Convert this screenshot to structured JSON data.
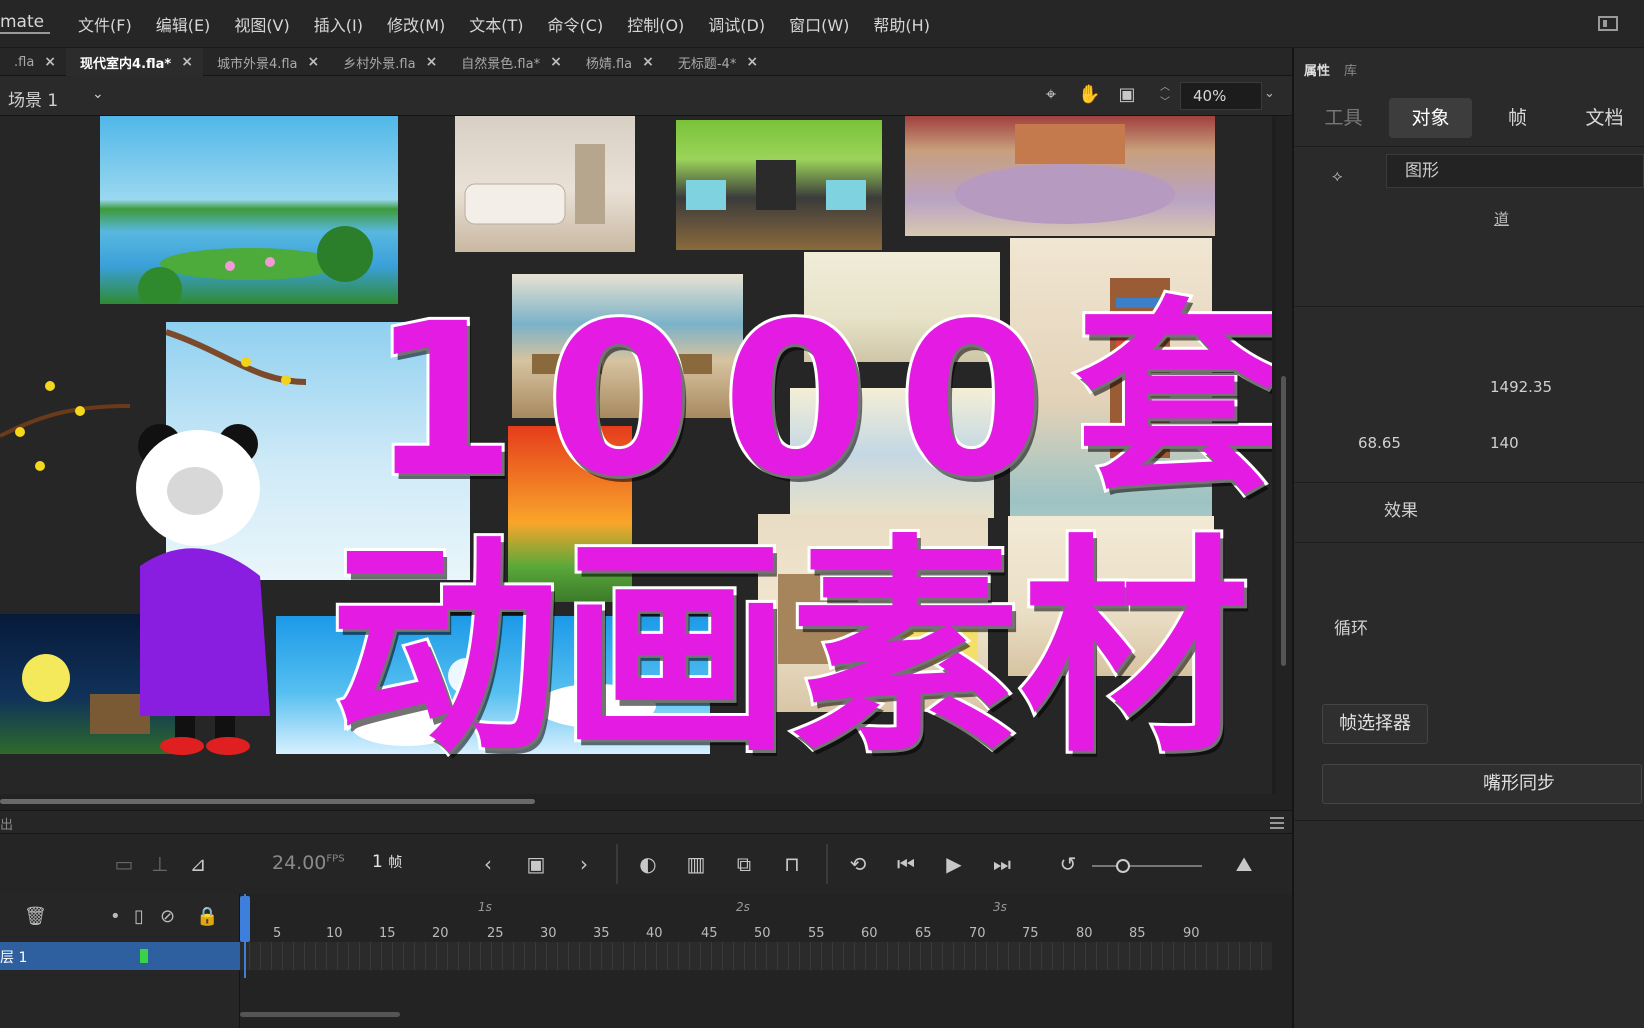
{
  "app": {
    "name": "mate"
  },
  "menu": [
    "文件(F)",
    "编辑(E)",
    "视图(V)",
    "插入(I)",
    "修改(M)",
    "文本(T)",
    "命令(C)",
    "控制(O)",
    "调试(D)",
    "窗口(W)",
    "帮助(H)"
  ],
  "tabs": [
    {
      "label": ".fla",
      "active": false
    },
    {
      "label": "现代室内4.fla*",
      "active": true
    },
    {
      "label": "城市外景4.fla",
      "active": false
    },
    {
      "label": "乡村外景.fla",
      "active": false
    },
    {
      "label": "自然景色.fla*",
      "active": false
    },
    {
      "label": "杨婧.fla",
      "active": false
    },
    {
      "label": "无标题-4*",
      "active": false
    }
  ],
  "stage": {
    "scene": "场景 1",
    "zoom": "40%",
    "overlay_line1": "1000套",
    "overlay_line2": "动画素材"
  },
  "panel": {
    "top_tabs": [
      "属性",
      "库"
    ],
    "sub_tabs": [
      "工具",
      "对象",
      "帧",
      "文档"
    ],
    "active_sub_tab": "对象",
    "type_field": "图形",
    "link_text": "道",
    "value_a": "1492.35",
    "value_b_left": "68.65",
    "value_b_right": "140",
    "section_effect": "效果",
    "section_loop": "循环",
    "frame_picker_button": "帧选择器",
    "lip_sync_button": "嘴形同步"
  },
  "timeline": {
    "header_label": "出",
    "fps": "24.00",
    "fps_unit": "FPS",
    "frame_number": "1",
    "frame_unit": "帧",
    "layer_name": "层 1",
    "ruler_ticks": [
      "5",
      "10",
      "15",
      "20",
      "25",
      "30",
      "35",
      "40",
      "45",
      "50",
      "55",
      "60",
      "65",
      "70",
      "75",
      "80",
      "85",
      "90"
    ],
    "seconds": [
      "1s",
      "2s",
      "3s"
    ]
  },
  "colors": {
    "accent": "#e31be3",
    "layer_selected": "#2e5f9e",
    "playhead": "#3d7fdb",
    "layer_marker": "#39d34a"
  }
}
